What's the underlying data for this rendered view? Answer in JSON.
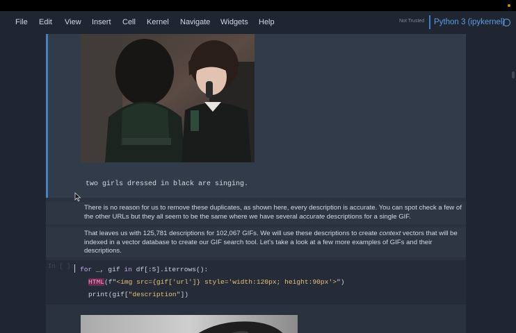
{
  "menu": [
    "File",
    "Edit",
    "View",
    "Insert",
    "Cell",
    "Kernel",
    "Navigate",
    "Widgets",
    "Help"
  ],
  "trust_status": "Not Trusted",
  "kernel": "Python 3 (ipykernel)",
  "output": {
    "image_alt": "gif frame",
    "description": "two girls dressed in black are singing."
  },
  "markdown": {
    "p1": "There is no reason for us to remove these duplicates, as shown here, every description is accurate. You can spot check a few of the other URLs but they all seem to be the same where we have several ",
    "p1_em": "accurate",
    "p1_end": " descriptions for a single GIF.",
    "p2": "That leaves us with 125,781 descriptions for 102,067 GIFs. We will use these descriptions to create ",
    "p2_em": "context",
    "p2_end": " vectors that will be indexed in a vector database to create our GIF search tool. Let's take a look at a few more examples of GIFs and their descriptions."
  },
  "code": {
    "prompt": "In [ ]:",
    "line1_a": "for",
    "line1_b": " _, gif ",
    "line1_c": "in",
    "line1_d": " df[:5].iterrows():",
    "line2_fn": "HTML",
    "line2_a": "(f\"",
    "line2_str": "<img src={gif['url']} style='width:120px; height:90px'>",
    "line2_b": "\")",
    "line3_a": "print",
    "line3_b": "(gif[",
    "line3_str": "\"description\"",
    "line3_c": "])"
  }
}
